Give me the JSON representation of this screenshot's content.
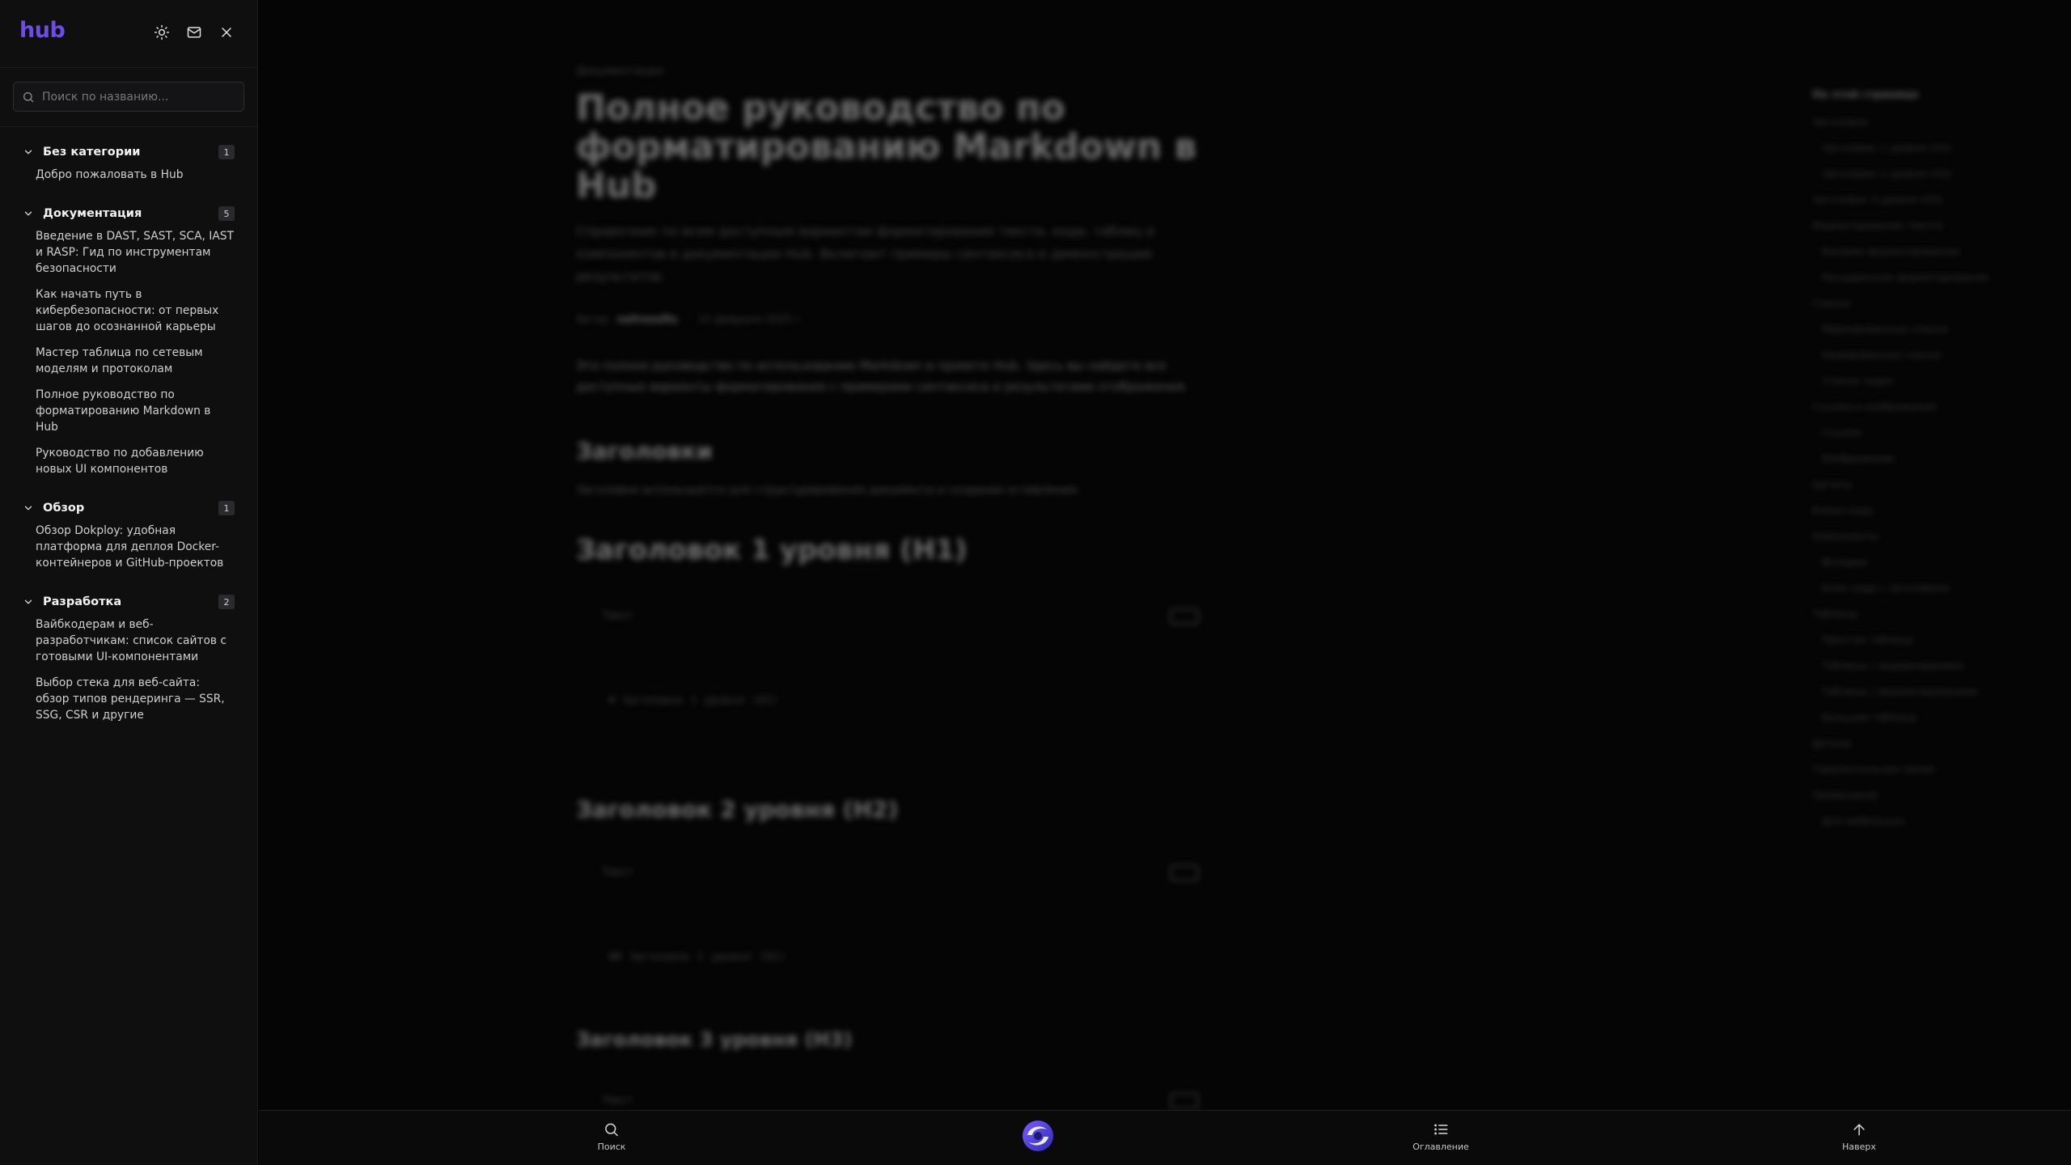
{
  "sidebar": {
    "logo": "hub",
    "header_icons": [
      "sun-icon",
      "mail-icon",
      "close-icon"
    ],
    "search": {
      "placeholder": "Поиск по названию...",
      "value": ""
    },
    "categories": [
      {
        "title": "Без категории",
        "count": "1",
        "items": [
          "Добро пожаловать в Hub"
        ]
      },
      {
        "title": "Документация",
        "count": "5",
        "items": [
          "Введение в DAST, SAST, SCA, IAST и RASP: Гид по инструментам безопасности",
          "Как начать путь в кибербезопасности: от первых шагов до осознанной карьеры",
          "Мастер таблица по сетевым моделям и протоколам",
          "Полное руководство по форматированию Markdown в Hub",
          "Руководство по добавлению новых UI компонентов"
        ]
      },
      {
        "title": "Обзор",
        "count": "1",
        "items": [
          "Обзор Dokploy: удобная платформа для деплоя Docker-контейнеров и GitHub-проектов"
        ]
      },
      {
        "title": "Разработка",
        "count": "2",
        "items": [
          "Вайбкодерам и веб-разработчикам: список сайтов с готовыми UI-компонентами",
          "Выбор стека для веб-сайта: обзор типов рендеринга — SSR, SSG, CSR и другие"
        ]
      }
    ]
  },
  "article": {
    "breadcrumb": "Документация",
    "title": "Полное руководство по форматированию Markdown в Hub",
    "description": "Справочник по всем доступным вариантам форматирования текста, кода, таблиц и компонентов в документации Hub. Включает примеры синтаксиса и демонстрацию результатов.",
    "meta_prefix": "Автор",
    "author": "nefrosofts",
    "date": "15 февраля 2025 г.",
    "intro": "Это полное руководство по использованию Markdown в проекте Hub. Здесь вы найдете все доступные варианты форматирования с примерами синтаксиса и результатами отображения.",
    "h2_headings": "Заголовки",
    "headings_desc": "Заголовки используются для структурирования документа и создания оглавления.",
    "demo_h1": "Заголовок 1 уровня (H1)",
    "code_label": "Текст",
    "code_h1": "# Заголовок 1 уровня (H1)",
    "demo_h2": "Заголовок 2 уровня (H2)",
    "code_h2": "## Заголовок 2 уровня (H2)",
    "demo_h3": "Заголовок 3 уровня (H3)"
  },
  "toc": {
    "title": "На этой странице",
    "items": [
      "Заголовки",
      "Заголовок 1 уровня (H1)",
      "Заголовок 2 уровня (H2)",
      "Заголовок 3 уровня (H3)",
      "Форматирование текста",
      "Базовое форматирование",
      "Расширенное форматирование",
      "Списки",
      "Маркированные списки",
      "Нумерованные списки",
      "Списки задач",
      "Ссылки и изображения",
      "Ссылки",
      "Изображения",
      "Цитаты",
      "Блоки кода",
      "Компоненты",
      "Вкладки",
      "Блок кода с заголовком",
      "Таблицы",
      "Простая таблица",
      "Таблица с выравниванием",
      "Таблица с форматированием",
      "Большая таблица",
      "Детали",
      "Горизонтальная линия",
      "Примечания",
      "Для мобильных"
    ]
  },
  "bottombar": {
    "search_label": "Поиск",
    "toc_label": "Оглавление",
    "top_label": "Наверх"
  }
}
